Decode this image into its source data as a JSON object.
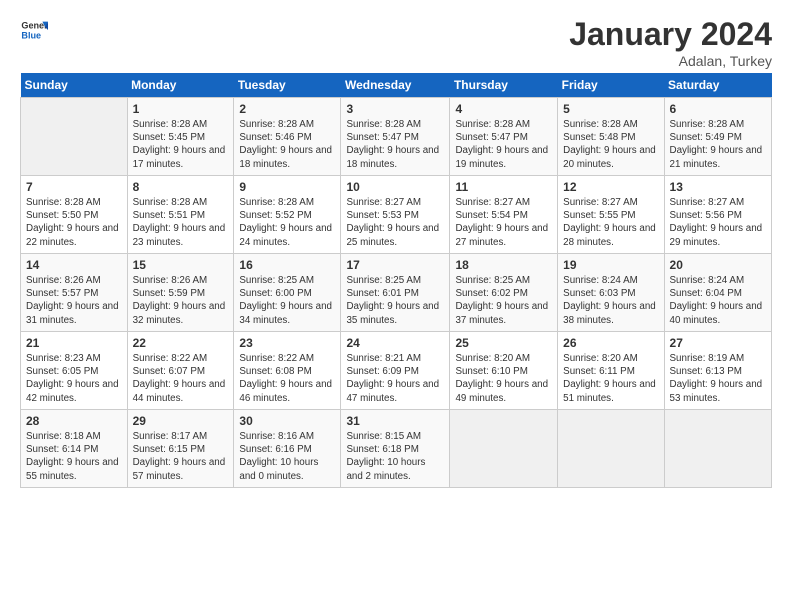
{
  "header": {
    "logo_general": "General",
    "logo_blue": "Blue",
    "month_year": "January 2024",
    "location": "Adalan, Turkey"
  },
  "days_of_week": [
    "Sunday",
    "Monday",
    "Tuesday",
    "Wednesday",
    "Thursday",
    "Friday",
    "Saturday"
  ],
  "weeks": [
    [
      {
        "day": "",
        "empty": true
      },
      {
        "day": "1",
        "sunrise": "Sunrise: 8:28 AM",
        "sunset": "Sunset: 5:45 PM",
        "daylight": "Daylight: 9 hours and 17 minutes."
      },
      {
        "day": "2",
        "sunrise": "Sunrise: 8:28 AM",
        "sunset": "Sunset: 5:46 PM",
        "daylight": "Daylight: 9 hours and 18 minutes."
      },
      {
        "day": "3",
        "sunrise": "Sunrise: 8:28 AM",
        "sunset": "Sunset: 5:47 PM",
        "daylight": "Daylight: 9 hours and 18 minutes."
      },
      {
        "day": "4",
        "sunrise": "Sunrise: 8:28 AM",
        "sunset": "Sunset: 5:47 PM",
        "daylight": "Daylight: 9 hours and 19 minutes."
      },
      {
        "day": "5",
        "sunrise": "Sunrise: 8:28 AM",
        "sunset": "Sunset: 5:48 PM",
        "daylight": "Daylight: 9 hours and 20 minutes."
      },
      {
        "day": "6",
        "sunrise": "Sunrise: 8:28 AM",
        "sunset": "Sunset: 5:49 PM",
        "daylight": "Daylight: 9 hours and 21 minutes."
      }
    ],
    [
      {
        "day": "7",
        "sunrise": "Sunrise: 8:28 AM",
        "sunset": "Sunset: 5:50 PM",
        "daylight": "Daylight: 9 hours and 22 minutes."
      },
      {
        "day": "8",
        "sunrise": "Sunrise: 8:28 AM",
        "sunset": "Sunset: 5:51 PM",
        "daylight": "Daylight: 9 hours and 23 minutes."
      },
      {
        "day": "9",
        "sunrise": "Sunrise: 8:28 AM",
        "sunset": "Sunset: 5:52 PM",
        "daylight": "Daylight: 9 hours and 24 minutes."
      },
      {
        "day": "10",
        "sunrise": "Sunrise: 8:27 AM",
        "sunset": "Sunset: 5:53 PM",
        "daylight": "Daylight: 9 hours and 25 minutes."
      },
      {
        "day": "11",
        "sunrise": "Sunrise: 8:27 AM",
        "sunset": "Sunset: 5:54 PM",
        "daylight": "Daylight: 9 hours and 27 minutes."
      },
      {
        "day": "12",
        "sunrise": "Sunrise: 8:27 AM",
        "sunset": "Sunset: 5:55 PM",
        "daylight": "Daylight: 9 hours and 28 minutes."
      },
      {
        "day": "13",
        "sunrise": "Sunrise: 8:27 AM",
        "sunset": "Sunset: 5:56 PM",
        "daylight": "Daylight: 9 hours and 29 minutes."
      }
    ],
    [
      {
        "day": "14",
        "sunrise": "Sunrise: 8:26 AM",
        "sunset": "Sunset: 5:57 PM",
        "daylight": "Daylight: 9 hours and 31 minutes."
      },
      {
        "day": "15",
        "sunrise": "Sunrise: 8:26 AM",
        "sunset": "Sunset: 5:59 PM",
        "daylight": "Daylight: 9 hours and 32 minutes."
      },
      {
        "day": "16",
        "sunrise": "Sunrise: 8:25 AM",
        "sunset": "Sunset: 6:00 PM",
        "daylight": "Daylight: 9 hours and 34 minutes."
      },
      {
        "day": "17",
        "sunrise": "Sunrise: 8:25 AM",
        "sunset": "Sunset: 6:01 PM",
        "daylight": "Daylight: 9 hours and 35 minutes."
      },
      {
        "day": "18",
        "sunrise": "Sunrise: 8:25 AM",
        "sunset": "Sunset: 6:02 PM",
        "daylight": "Daylight: 9 hours and 37 minutes."
      },
      {
        "day": "19",
        "sunrise": "Sunrise: 8:24 AM",
        "sunset": "Sunset: 6:03 PM",
        "daylight": "Daylight: 9 hours and 38 minutes."
      },
      {
        "day": "20",
        "sunrise": "Sunrise: 8:24 AM",
        "sunset": "Sunset: 6:04 PM",
        "daylight": "Daylight: 9 hours and 40 minutes."
      }
    ],
    [
      {
        "day": "21",
        "sunrise": "Sunrise: 8:23 AM",
        "sunset": "Sunset: 6:05 PM",
        "daylight": "Daylight: 9 hours and 42 minutes."
      },
      {
        "day": "22",
        "sunrise": "Sunrise: 8:22 AM",
        "sunset": "Sunset: 6:07 PM",
        "daylight": "Daylight: 9 hours and 44 minutes."
      },
      {
        "day": "23",
        "sunrise": "Sunrise: 8:22 AM",
        "sunset": "Sunset: 6:08 PM",
        "daylight": "Daylight: 9 hours and 46 minutes."
      },
      {
        "day": "24",
        "sunrise": "Sunrise: 8:21 AM",
        "sunset": "Sunset: 6:09 PM",
        "daylight": "Daylight: 9 hours and 47 minutes."
      },
      {
        "day": "25",
        "sunrise": "Sunrise: 8:20 AM",
        "sunset": "Sunset: 6:10 PM",
        "daylight": "Daylight: 9 hours and 49 minutes."
      },
      {
        "day": "26",
        "sunrise": "Sunrise: 8:20 AM",
        "sunset": "Sunset: 6:11 PM",
        "daylight": "Daylight: 9 hours and 51 minutes."
      },
      {
        "day": "27",
        "sunrise": "Sunrise: 8:19 AM",
        "sunset": "Sunset: 6:13 PM",
        "daylight": "Daylight: 9 hours and 53 minutes."
      }
    ],
    [
      {
        "day": "28",
        "sunrise": "Sunrise: 8:18 AM",
        "sunset": "Sunset: 6:14 PM",
        "daylight": "Daylight: 9 hours and 55 minutes."
      },
      {
        "day": "29",
        "sunrise": "Sunrise: 8:17 AM",
        "sunset": "Sunset: 6:15 PM",
        "daylight": "Daylight: 9 hours and 57 minutes."
      },
      {
        "day": "30",
        "sunrise": "Sunrise: 8:16 AM",
        "sunset": "Sunset: 6:16 PM",
        "daylight": "Daylight: 10 hours and 0 minutes."
      },
      {
        "day": "31",
        "sunrise": "Sunrise: 8:15 AM",
        "sunset": "Sunset: 6:18 PM",
        "daylight": "Daylight: 10 hours and 2 minutes."
      },
      {
        "day": "",
        "empty": true
      },
      {
        "day": "",
        "empty": true
      },
      {
        "day": "",
        "empty": true
      }
    ]
  ]
}
